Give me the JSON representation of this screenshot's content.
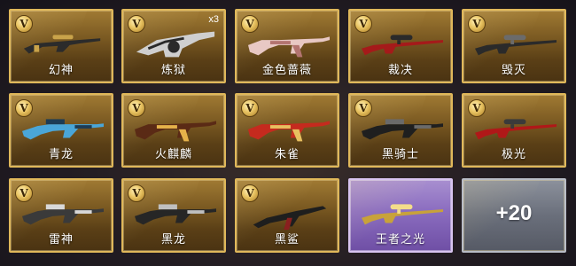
{
  "badge_letter": "V",
  "items": [
    {
      "label": "幻神",
      "count": "",
      "color": "#2b2b2b",
      "accent": "#c9a34a",
      "kind": "rifle"
    },
    {
      "label": "炼狱",
      "count": "x3",
      "color": "#cfcfcf",
      "accent": "#2a2a2a",
      "kind": "gatling"
    },
    {
      "label": "金色蔷薇",
      "count": "",
      "color": "#e8c8c4",
      "accent": "#b37470",
      "kind": "ak"
    },
    {
      "label": "裁决",
      "count": "",
      "color": "#a51a1a",
      "accent": "#2a2a2a",
      "kind": "sniper"
    },
    {
      "label": "毁灭",
      "count": "",
      "color": "#2a2a2a",
      "accent": "#6b6b6b",
      "kind": "sniper"
    },
    {
      "label": "青龙",
      "count": "",
      "color": "#4aa6d8",
      "accent": "#1d3c55",
      "kind": "m4"
    },
    {
      "label": "火麒麟",
      "count": "",
      "color": "#5a2a15",
      "accent": "#e5b24a",
      "kind": "ak"
    },
    {
      "label": "朱雀",
      "count": "",
      "color": "#c52a1e",
      "accent": "#e8c060",
      "kind": "ak"
    },
    {
      "label": "黑骑士",
      "count": "",
      "color": "#1f1f1f",
      "accent": "#6a6a6a",
      "kind": "m4"
    },
    {
      "label": "极光",
      "count": "",
      "color": "#b01818",
      "accent": "#3a3a3a",
      "kind": "sniper"
    },
    {
      "label": "雷神",
      "count": "",
      "color": "#3a3a3a",
      "accent": "#d8d8d8",
      "kind": "m4"
    },
    {
      "label": "黑龙",
      "count": "",
      "color": "#262626",
      "accent": "#bfbfbf",
      "kind": "m4"
    },
    {
      "label": "黑鲨",
      "count": "",
      "color": "#1e1e1e",
      "accent": "#8a1f1f",
      "kind": "smg"
    },
    {
      "label": "王者之光",
      "count": "",
      "color": "#c8a23a",
      "accent": "#f3dd8a",
      "kind": "sniper",
      "rarity": "purple"
    }
  ],
  "more": {
    "label": "+20"
  }
}
